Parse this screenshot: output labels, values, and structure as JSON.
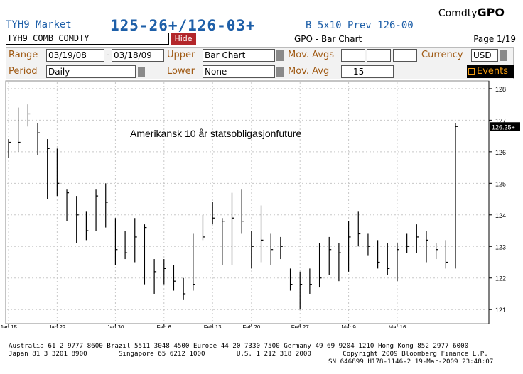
{
  "header": {
    "ticker": "TYH9",
    "market": "Market",
    "quote": "125-26+/126-03+",
    "quote_rest": "B  5x10 Prev 126-00",
    "brand_prefix": "Comdty",
    "brand_name": "GPO"
  },
  "toolbar": {
    "security": "TYH9 COMB COMDTY",
    "hide_label": "Hide",
    "title": "GPO - Bar Chart",
    "page": "Page 1/19"
  },
  "settings": {
    "range_label": "Range",
    "range_start": "03/19/08",
    "range_sep": "-",
    "range_end": "03/18/09",
    "upper_label": "Upper",
    "upper_value": "Bar Chart",
    "mov_avgs_label": "Mov. Avgs",
    "currency_label": "Currency",
    "currency_value": "USD",
    "period_label": "Period",
    "period_value": "Daily",
    "lower_label": "Lower",
    "lower_value": "None",
    "mov_avg_label": "Mov. Avg",
    "mov_avg_value": "15",
    "events_label": "Events"
  },
  "chart_data": {
    "type": "bar",
    "annotation": "Amerikansk 10 år statsobligasjonfuture",
    "last_price_label": "126.25+",
    "ylim": [
      120.6,
      128.2
    ],
    "y_ticks": [
      "121",
      "122",
      "123",
      "124",
      "125",
      "126",
      "127",
      "128"
    ],
    "x_ticks": [
      "Jan 15",
      "Jan 22",
      "Jan 30",
      "Feb 6",
      "Feb 13",
      "Feb 20",
      "Feb 27",
      "Mar 9",
      "Mar 16"
    ],
    "x_tick_positions": [
      0,
      5,
      11,
      16,
      21,
      25,
      30,
      35,
      40
    ],
    "bars": [
      {
        "i": 0,
        "high": 126.4,
        "low": 125.8,
        "close": 126.3
      },
      {
        "i": 1,
        "high": 127.4,
        "low": 126.0,
        "close": 126.3
      },
      {
        "i": 2,
        "high": 127.5,
        "low": 126.8,
        "close": 127.2
      },
      {
        "i": 3,
        "high": 126.9,
        "low": 125.9,
        "close": 126.6
      },
      {
        "i": 4,
        "high": 126.4,
        "low": 124.5,
        "close": 126.1
      },
      {
        "i": 5,
        "high": 126.1,
        "low": 124.6,
        "close": 125.0
      },
      {
        "i": 6,
        "high": 124.8,
        "low": 123.8,
        "close": 124.7
      },
      {
        "i": 7,
        "high": 124.6,
        "low": 123.1,
        "close": 124.0
      },
      {
        "i": 8,
        "high": 124.1,
        "low": 123.2,
        "close": 123.5
      },
      {
        "i": 9,
        "high": 124.8,
        "low": 123.5,
        "close": 124.6
      },
      {
        "i": 10,
        "high": 125.0,
        "low": 123.6,
        "close": 124.4
      },
      {
        "i": 11,
        "high": 123.9,
        "low": 122.4,
        "close": 122.9
      },
      {
        "i": 12,
        "high": 123.5,
        "low": 122.6,
        "close": 122.8
      },
      {
        "i": 13,
        "high": 123.9,
        "low": 122.5,
        "close": 123.3
      },
      {
        "i": 14,
        "high": 123.7,
        "low": 121.8,
        "close": 123.6
      },
      {
        "i": 15,
        "high": 122.6,
        "low": 121.5,
        "close": 122.2
      },
      {
        "i": 16,
        "high": 122.6,
        "low": 121.8,
        "close": 122.3
      },
      {
        "i": 17,
        "high": 122.4,
        "low": 121.6,
        "close": 121.9
      },
      {
        "i": 18,
        "high": 122.0,
        "low": 121.3,
        "close": 121.5
      },
      {
        "i": 19,
        "high": 123.4,
        "low": 121.6,
        "close": 121.8
      },
      {
        "i": 20,
        "high": 124.0,
        "low": 123.2,
        "close": 123.3
      },
      {
        "i": 21,
        "high": 124.4,
        "low": 123.7,
        "close": 123.9
      },
      {
        "i": 22,
        "high": 123.9,
        "low": 122.4,
        "close": 123.8
      },
      {
        "i": 23,
        "high": 124.7,
        "low": 122.4,
        "close": 123.9
      },
      {
        "i": 24,
        "high": 124.8,
        "low": 123.4,
        "close": 123.8
      },
      {
        "i": 25,
        "high": 123.5,
        "low": 122.3,
        "close": 123.0
      },
      {
        "i": 26,
        "high": 124.3,
        "low": 122.5,
        "close": 123.2
      },
      {
        "i": 27,
        "high": 123.4,
        "low": 122.4,
        "close": 122.9
      },
      {
        "i": 28,
        "high": 123.3,
        "low": 122.6,
        "close": 123.0
      },
      {
        "i": 29,
        "high": 122.3,
        "low": 121.6,
        "close": 121.8
      },
      {
        "i": 30,
        "high": 122.2,
        "low": 121.0,
        "close": 121.8
      },
      {
        "i": 31,
        "high": 122.3,
        "low": 121.5,
        "close": 121.8
      },
      {
        "i": 32,
        "high": 123.1,
        "low": 121.7,
        "close": 122.0
      },
      {
        "i": 33,
        "high": 123.3,
        "low": 122.1,
        "close": 122.9
      },
      {
        "i": 34,
        "high": 123.1,
        "low": 121.9,
        "close": 122.8
      },
      {
        "i": 35,
        "high": 123.8,
        "low": 122.2,
        "close": 123.3
      },
      {
        "i": 36,
        "high": 124.1,
        "low": 123.0,
        "close": 123.4
      },
      {
        "i": 37,
        "high": 123.4,
        "low": 122.7,
        "close": 123.0
      },
      {
        "i": 38,
        "high": 123.2,
        "low": 122.3,
        "close": 122.5
      },
      {
        "i": 39,
        "high": 123.1,
        "low": 122.1,
        "close": 122.3
      },
      {
        "i": 40,
        "high": 123.1,
        "low": 121.9,
        "close": 122.9
      },
      {
        "i": 41,
        "high": 123.4,
        "low": 122.8,
        "close": 123.0
      },
      {
        "i": 42,
        "high": 123.7,
        "low": 122.8,
        "close": 123.3
      },
      {
        "i": 43,
        "high": 123.5,
        "low": 122.5,
        "close": 123.2
      },
      {
        "i": 44,
        "high": 123.1,
        "low": 122.6,
        "close": 122.9
      },
      {
        "i": 45,
        "high": 123.2,
        "low": 122.3,
        "close": 122.5
      },
      {
        "i": 46,
        "high": 126.9,
        "low": 122.3,
        "close": 126.8
      }
    ]
  },
  "footer": {
    "line1": "Australia 61 2 9777 8600 Brazil 5511 3048 4500 Europe 44 20 7330 7500 Germany 49 69 9204 1210 Hong Kong 852 2977 6000",
    "line2": "Japan 81 3 3201 8900        Singapore 65 6212 1000        U.S. 1 212 318 2000        Copyright 2009 Bloomberg Finance L.P.",
    "line3": "SN 646899 H178-1146-2 19-Mar-2009 23:48:07"
  }
}
